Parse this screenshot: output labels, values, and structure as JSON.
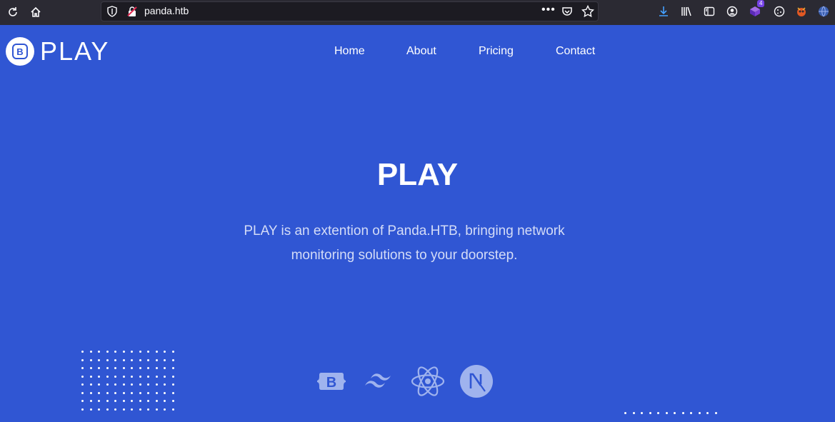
{
  "browser": {
    "url": "panda.htb",
    "more_label": "•••",
    "extension_badge": "4"
  },
  "site": {
    "logo_letter": "B",
    "logo_text": "PLAY",
    "nav": [
      "Home",
      "About",
      "Pricing",
      "Contact"
    ]
  },
  "hero": {
    "title": "PLAY",
    "description": "PLAY is an extention of Panda.HTB, bringing network monitoring solutions to your doorstep."
  },
  "brands": [
    "bootstrap-icon",
    "tailwind-icon",
    "react-icon",
    "nextjs-icon"
  ],
  "colors": {
    "background": "#3056d3",
    "chrome": "#2b2a33",
    "brand_icon": "#9fb3ee"
  }
}
